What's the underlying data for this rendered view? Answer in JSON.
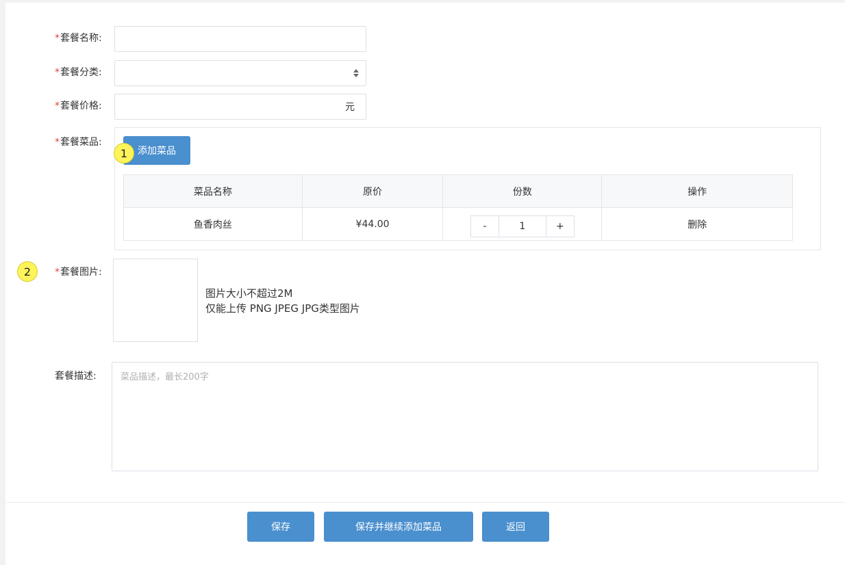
{
  "form": {
    "name_label": "套餐名称:",
    "category_label": "套餐分类:",
    "price_label": "套餐价格:",
    "price_unit": "元",
    "dishes_label": "套餐菜品:",
    "image_label": "套餐图片:",
    "desc_label": "套餐描述:",
    "required_mark": "*",
    "desc_placeholder": "菜品描述，最长200字"
  },
  "dishes": {
    "add_button": "添加菜品",
    "headers": [
      "菜品名称",
      "原价",
      "份数",
      "操作"
    ],
    "rows": [
      {
        "name": "鱼香肉丝",
        "price": "¥44.00",
        "qty": "1",
        "action": "删除"
      }
    ],
    "minus": "-",
    "plus": "+"
  },
  "upload": {
    "tip_line1": "图片大小不超过2M",
    "tip_line2": "仅能上传 PNG JPEG JPG类型图片"
  },
  "actions": {
    "save": "保存",
    "save_continue": "保存并继续添加菜品",
    "back": "返回"
  },
  "markers": {
    "m1": "1",
    "m2": "2"
  },
  "colors": {
    "primary": "#4a8fce",
    "required": "#e0443a",
    "marker": "#fdf35a"
  }
}
